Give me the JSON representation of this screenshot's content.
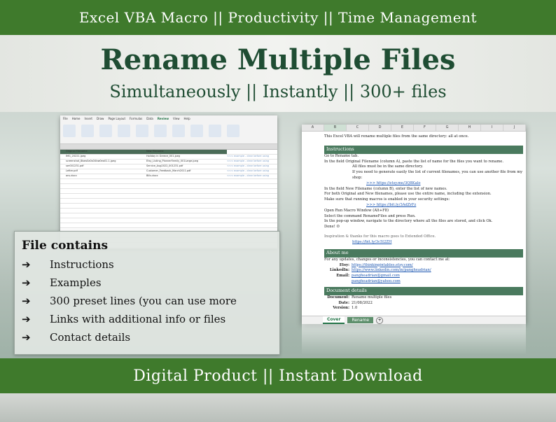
{
  "top_banner": "Excel VBA Macro || Productivity || Time Management",
  "title": "Rename Multiple Files",
  "subtitle": "Simultaneously || Instantly || 300+ files",
  "left_sheet": {
    "tabs": [
      "File",
      "Home",
      "Insert",
      "Draw",
      "Page Layout",
      "Formulas",
      "Data",
      "Review",
      "View",
      "Help"
    ],
    "headers": [
      "Original Filename",
      "New Filename"
    ],
    "rows": [
      [
        "IMG_20221.jpeg",
        "Holiday in Greece_001.jpeg",
        "<<< example - clear before using"
      ],
      [
        "screenshot_8kaw0a0s0Ubw0ea01.1.jpeg",
        "Etsy_Listing_PlannerFamily_001Large.jpeg",
        "<<< example - clear before using"
      ],
      [
        "ser001231.pdf",
        "Service_Aug2022_001231.pdf",
        "<<< example - clear before using"
      ],
      [
        "Letter.pdf",
        "Customer_Feedback_March2011.pdf",
        "<<< example - clear before using"
      ],
      [
        "ans.docx",
        "Bills.docx",
        "<<< example - clear before using"
      ]
    ]
  },
  "right_sheet": {
    "columns": [
      "A",
      "B",
      "C",
      "D",
      "E",
      "F",
      "G",
      "H",
      "I",
      "J"
    ],
    "intro": "This Excel VBA will rename multiple files from the same directory: all at once.",
    "instructions_title": "Instructions",
    "instructions": [
      "Go to Rename tab.",
      "In the field Original Filename (column A), paste the list of name for the files you want to rename.",
      "All files must be in the same directory.",
      "If you need to generate easily the list of current filenames, you can use another file from my shop:",
      ">>> https://etsy.me/3Q8Kalo",
      "In the field New Filename (column B), enter the list of new names.",
      "For both Original and New filenames, please use the entire name, including the extension.",
      "Make sure that running macros is enabled in your security settings:",
      ">>> https://bit.ly/3AdZrFz",
      "Open Run Macro Window (Alt+F8)",
      "Select the command RenameFiles and press Run.",
      "In the pop-up window, navigate to the directory where all the files are stored, and click Ok.",
      "Done! ☺"
    ],
    "inspiration": "Inspiration & thanks for this macro goes to Extended Office.",
    "inspiration_link": "https://bit.ly/3c5l2ZH",
    "about_title": "About me",
    "about_intro": "For any updates, changes or inconsistencies, you can contact me at:",
    "about": [
      {
        "label": "Etsy:",
        "value": "https://thinkingintables.etsy.com/"
      },
      {
        "label": "LinkedIn:",
        "value": "https://www.linkedin.com/in/pangheadrian/"
      },
      {
        "label": "Email:",
        "value": "pangheadrian@gmail.com"
      },
      {
        "label": "",
        "value": "pangheadrian@yahoo.com"
      }
    ],
    "doc_title": "Document details",
    "doc": [
      {
        "label": "Document:",
        "value": "Rename multiple files"
      },
      {
        "label": "Date:",
        "value": "21/08/2022"
      },
      {
        "label": "Version:",
        "value": "1.0"
      }
    ],
    "sheet_tabs": [
      "Cover",
      "Rename"
    ]
  },
  "file_contains": {
    "title": "File contains",
    "items": [
      "Instructions",
      "Examples",
      "300 preset lines (you can use more",
      "Links with additional info or files",
      "Contact details"
    ],
    "arrow": "➔"
  },
  "bottom_banner": "Digital Product || Instant Download"
}
